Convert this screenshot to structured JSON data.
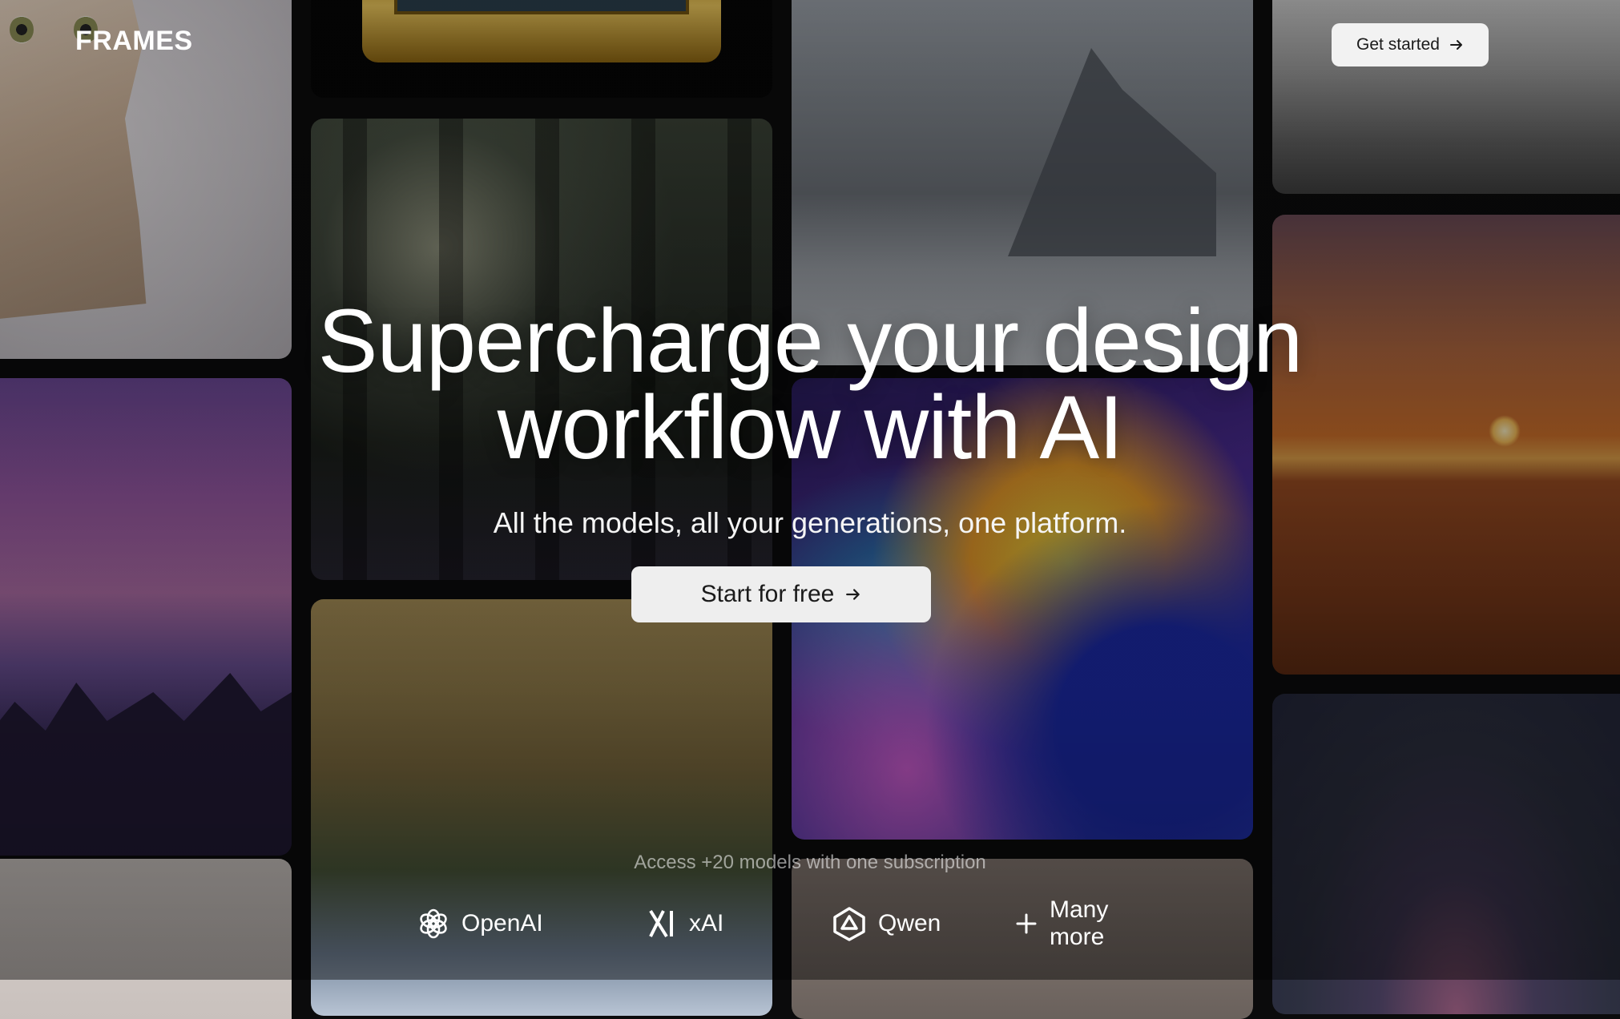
{
  "brand": {
    "name": "FRAMES"
  },
  "header": {
    "cta_label": "Get started",
    "cta_icon": "arrow-right-icon"
  },
  "hero": {
    "headline_line1": "Supercharge your design",
    "headline_line2": "workflow with AI",
    "subtitle": "All the models, all your generations, one platform.",
    "primary_cta_label": "Start for free",
    "primary_cta_icon": "arrow-right-icon"
  },
  "models": {
    "caption": "Access +20 models with one subscription",
    "items": [
      {
        "label": "OpenAI",
        "icon": "openai-logo-icon"
      },
      {
        "label": "xAI",
        "icon": "xai-logo-icon"
      },
      {
        "label": "Qwen",
        "icon": "qwen-logo-icon"
      },
      {
        "label": "Many more",
        "icon": "plus-icon"
      }
    ]
  },
  "colors": {
    "background": "#0b0b0c",
    "button_bg": "#eeeeee",
    "button_text": "#1b1b1b",
    "text": "#ffffff"
  }
}
